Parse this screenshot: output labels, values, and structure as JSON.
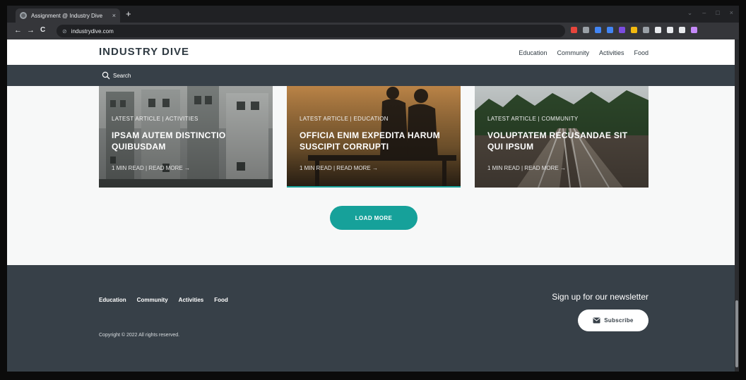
{
  "browser": {
    "tab_title": "Assignment @ Industry Dive",
    "tab_close": "×",
    "new_tab": "+",
    "url": "industrydive.com",
    "back": "←",
    "forward": "→",
    "reload": "C",
    "window_controls": [
      "⌄",
      "–",
      "□",
      "×"
    ],
    "extension_colors": [
      "#e8453c",
      "#9aa0a6",
      "#4285f4",
      "#4285f4",
      "#7b4ce0",
      "#f2b90f",
      "#9aa0a6",
      "#e8eaed",
      "#e8eaed",
      "#e8eaed",
      "#c58af9"
    ]
  },
  "header": {
    "brand": "INDUSTRY DIVE",
    "nav": [
      "Education",
      "Community",
      "Activities",
      "Food"
    ]
  },
  "search": {
    "placeholder": "Search",
    "icon": "search-icon"
  },
  "cards": [
    {
      "meta": "LATEST ARTICLE | ACTIVITIES",
      "title": "IPSAM AUTEM DISTINCTIO QUIBUSDAM",
      "read": "1 MIN READ | READ MORE →",
      "image": "building-photo"
    },
    {
      "meta": "LATEST ARTICLE | EDUCATION",
      "title": "OFFICIA ENIM EXPEDITA HARUM SUSCIPIT CORRUPTI",
      "read": "1 MIN READ | READ MORE →",
      "image": "couple-sunset-photo"
    },
    {
      "meta": "LATEST ARTICLE | COMMUNITY",
      "title": "VOLUPTATEM RECUSANDAE SIT QUI IPSUM",
      "read": "1 MIN READ | READ MORE →",
      "image": "railway-forest-photo"
    }
  ],
  "load_more": "LOAD MORE",
  "footer": {
    "nav": [
      "Education",
      "Community",
      "Activities",
      "Food"
    ],
    "copyright": "Copyright © 2022 All rights reserved.",
    "newsletter_title": "Sign up for our newsletter",
    "subscribe": "Subscribe"
  },
  "colors": {
    "accent": "#16a19a",
    "dark": "#374048",
    "page_bg": "#f7f8f8"
  }
}
